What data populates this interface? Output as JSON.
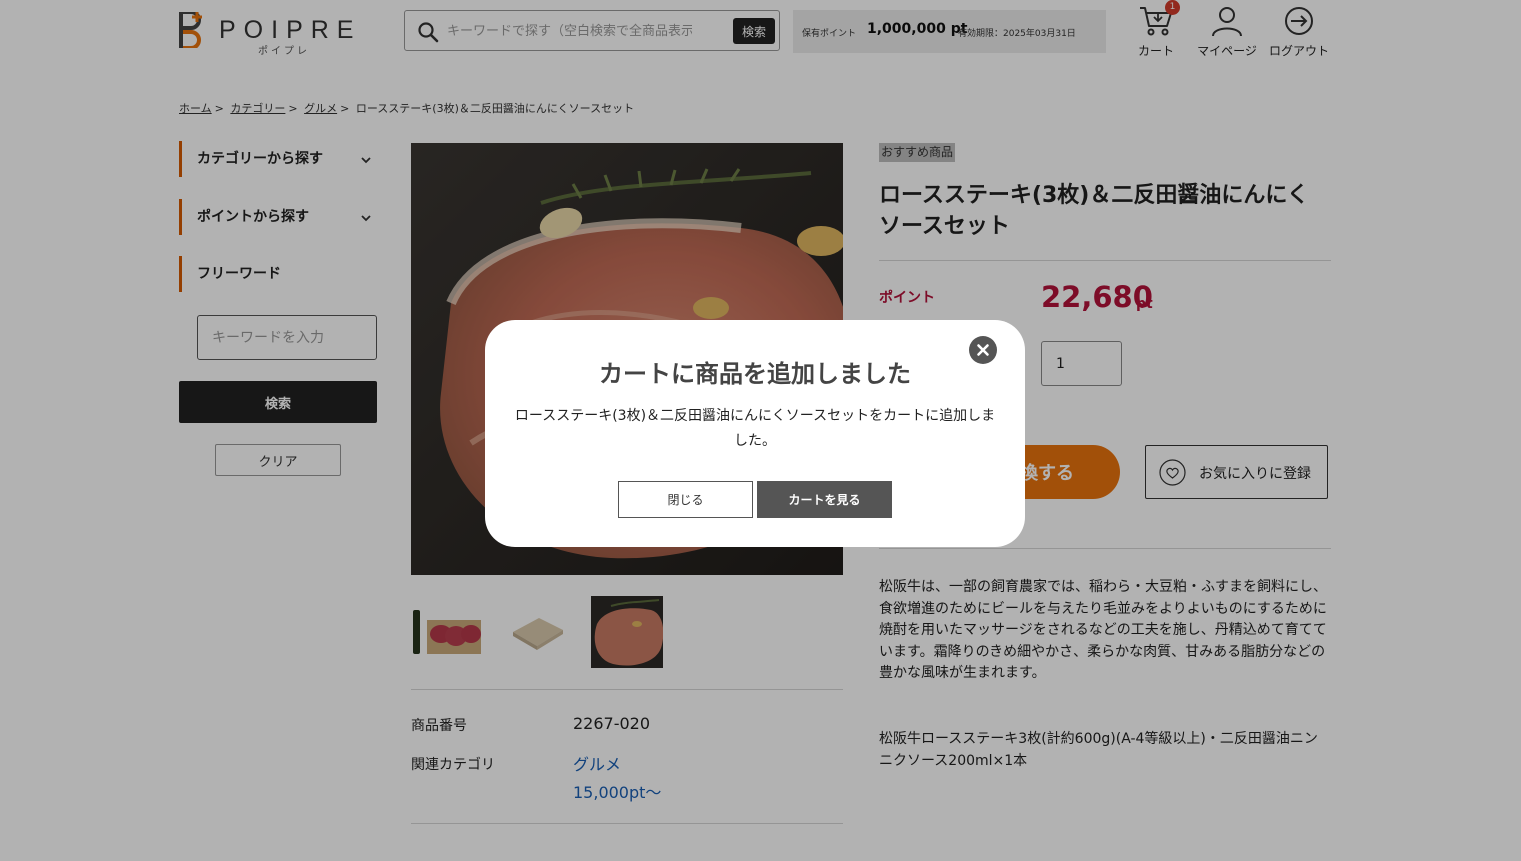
{
  "header": {
    "logo_text": "POIPRE",
    "logo_sub": "ポイプレ",
    "search": {
      "placeholder": "キーワードで探す（空白検索で全商品表示）",
      "button": "検索"
    },
    "points": {
      "label": "保有ポイント",
      "value": "1,000,000 pt",
      "expiry": "有効期限：2025年03月31日"
    },
    "nav": {
      "cart": "カート",
      "cart_count": "1",
      "mypage": "マイページ",
      "logout": "ログアウト"
    }
  },
  "breadcrumb": {
    "home": "ホーム",
    "category": "カテゴリー",
    "gourmet": "グルメ",
    "current": "ロースステーキ(3枚)＆二反田醤油にんにくソースセット",
    "separator": ">"
  },
  "sidebar": {
    "category_title": "カテゴリーから探す",
    "points_title": "ポイントから探す",
    "freeword_title": "フリーワード",
    "input_placeholder": "キーワードを入力",
    "search_button": "検索",
    "clear_button": "クリア"
  },
  "product": {
    "badge": "おすすめ商品",
    "title": "ロースステーキ(3枚)＆二反田醤油にんにくソースセット",
    "point_label": "ポイント",
    "point_value": "22,680",
    "point_unit": "pt",
    "quantity": "1",
    "exchange_button_visible": "換する",
    "favorite_button": "お気に入りに登録",
    "spec": {
      "number_label": "商品番号",
      "number_value": "2267-020",
      "category_label": "関連カテゴリ",
      "category_links": [
        "グルメ",
        "15,000pt〜"
      ]
    },
    "description": "松阪牛は、一部の飼育農家では、稲わら・大豆粕・ふすまを飼料にし、食欲増進のためにビールを与えたり毛並みをよりよいものにするために焼酎を用いたマッサージをされるなどの工夫を施し、丹精込めて育てています。霜降りのきめ細やかさ、柔らかな肉質、甘みある脂肪分などの豊かな風味が生まれます。",
    "contents": "松阪牛ロースステーキ3枚(計約600g)(A-4等級以上)・二反田醤油ニンニクソース200ml×1本"
  },
  "modal": {
    "title": "カートに商品を追加しました",
    "message": "ロースステーキ(3枚)＆二反田醤油にんにくソースセットをカートに追加しました。",
    "close_button": "閉じる",
    "cart_button": "カートを見る"
  },
  "colors": {
    "accent_orange": "#d45a00",
    "point_red": "#b3123a",
    "exchange_orange": "#e8730d",
    "link_blue": "#1a5fb4"
  }
}
